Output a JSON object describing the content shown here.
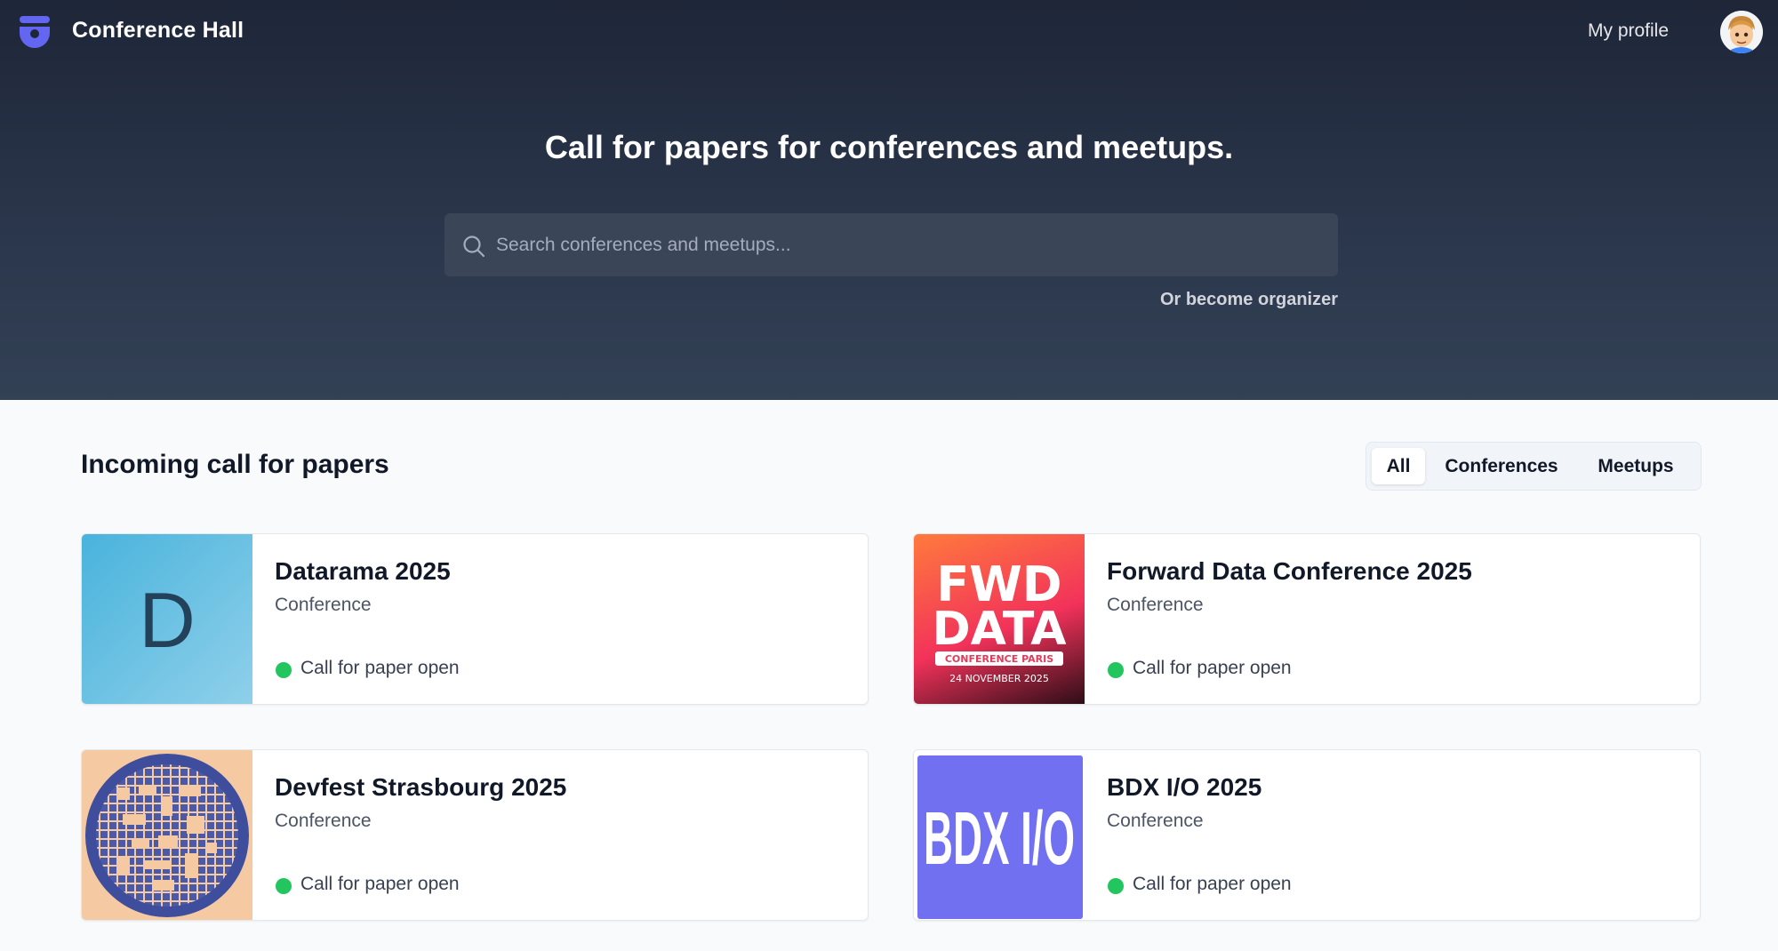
{
  "app": {
    "title": "Conference Hall"
  },
  "nav": {
    "profile_label": "My profile"
  },
  "hero": {
    "headline": "Call for papers for conferences and meetups.",
    "search_placeholder": "Search conferences and meetups...",
    "organizer_link": "Or become organizer"
  },
  "section": {
    "title": "Incoming call for papers",
    "filters": [
      {
        "label": "All",
        "active": true
      },
      {
        "label": "Conferences",
        "active": false
      },
      {
        "label": "Meetups",
        "active": false
      }
    ]
  },
  "events": [
    {
      "title": "Datarama 2025",
      "type": "Conference",
      "status": "Call for paper open",
      "logo_letter": "D"
    },
    {
      "title": "Forward Data Conference 2025",
      "type": "Conference",
      "status": "Call for paper open",
      "logo_text": [
        "FWD",
        "DATA",
        "CONFERENCE PARIS",
        "24 NOVEMBER 2025"
      ]
    },
    {
      "title": "Devfest Strasbourg 2025",
      "type": "Conference",
      "status": "Call for paper open"
    },
    {
      "title": "BDX I/O 2025",
      "type": "Conference",
      "status": "Call for paper open",
      "logo_text": "BDX I/O"
    }
  ],
  "colors": {
    "status_open": "#22c55e",
    "brand": "#6366f1"
  },
  "icons": {
    "logo": "conference-hall-logo-icon",
    "search": "search-icon",
    "status": "status-dot-icon"
  }
}
